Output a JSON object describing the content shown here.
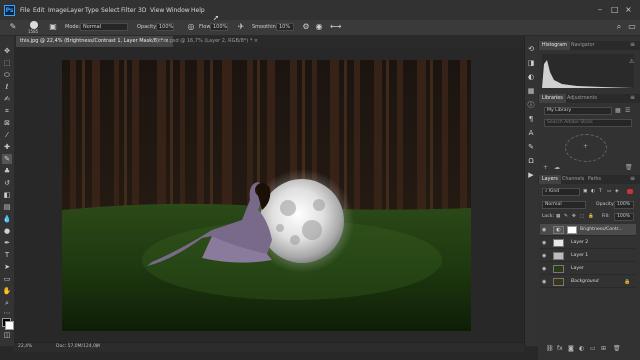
{
  "app": {
    "logo": "Ps"
  },
  "menu": [
    "File",
    "Edit",
    "Image",
    "Layer",
    "Type",
    "Select",
    "Filter",
    "3D",
    "View",
    "Window",
    "Help"
  ],
  "window_controls": {
    "minimize": "–",
    "maximize": "□",
    "close": "×"
  },
  "options": {
    "brush_size": "1585",
    "mode_label": "Mode:",
    "mode_value": "Normal",
    "opacity_label": "Opacity:",
    "opacity_value": "100%",
    "flow_label": "Flow:",
    "flow_value": "100%",
    "smoothing_label": "Smoothing:",
    "smoothing_value": "10%"
  },
  "tabs": [
    {
      "label": "this.jpg @ 22,4% (Brightness/Contrast 1, Layer Mask/8) * ×"
    },
    {
      "label": "this.psd @ 16,7% (Layer 2, RGB/8*) * ×"
    }
  ],
  "status": {
    "zoom": "22,4%",
    "doc": "Doc: 57,0M/124,0M"
  },
  "histogram": {
    "tab_active": "Histogram",
    "tab_inactive": "Navigator"
  },
  "libraries": {
    "tab_active": "Libraries",
    "tab_inactive": "Adjustments",
    "library_name": "My Library",
    "search_placeholder": "Search Adobe Stock"
  },
  "layers_panel": {
    "tabs": [
      "Layers",
      "Channels",
      "Paths"
    ],
    "filter_kind": "Kind",
    "blend_mode": "Normal",
    "opacity_label": "Opacity:",
    "opacity_value": "100%",
    "lock_label": "Lock:",
    "fill_label": "Fill:",
    "fill_value": "100%",
    "layers": [
      {
        "name": "Brightness/Contr...",
        "selected": true
      },
      {
        "name": "Layer 2",
        "selected": false
      },
      {
        "name": "Layer 1",
        "selected": false
      },
      {
        "name": "Layer",
        "selected": false
      },
      {
        "name": "Background",
        "selected": false
      }
    ]
  },
  "icons": {
    "tools": [
      "move-icon",
      "artboard-icon",
      "marquee-icon",
      "lasso-icon",
      "quick-select-icon",
      "crop-icon",
      "frame-icon",
      "eyedropper-icon",
      "healing-icon",
      "brush-icon",
      "clone-stamp-icon",
      "history-brush-icon",
      "eraser-icon",
      "gradient-icon",
      "blur-icon",
      "dodge-icon",
      "pen-icon",
      "type-icon",
      "path-select-icon",
      "rectangle-icon",
      "hand-icon",
      "zoom-icon",
      "more-tools-icon"
    ],
    "dock": [
      "history-icon",
      "properties-icon",
      "color-icon",
      "swatches-icon",
      "info-icon",
      "paragraph-icon",
      "character-icon",
      "brushes-icon",
      "glyphs-icon",
      "actions-icon"
    ]
  },
  "colors": {
    "accent": "#31a8ff",
    "panel": "#323232",
    "canvas": "#282828"
  }
}
